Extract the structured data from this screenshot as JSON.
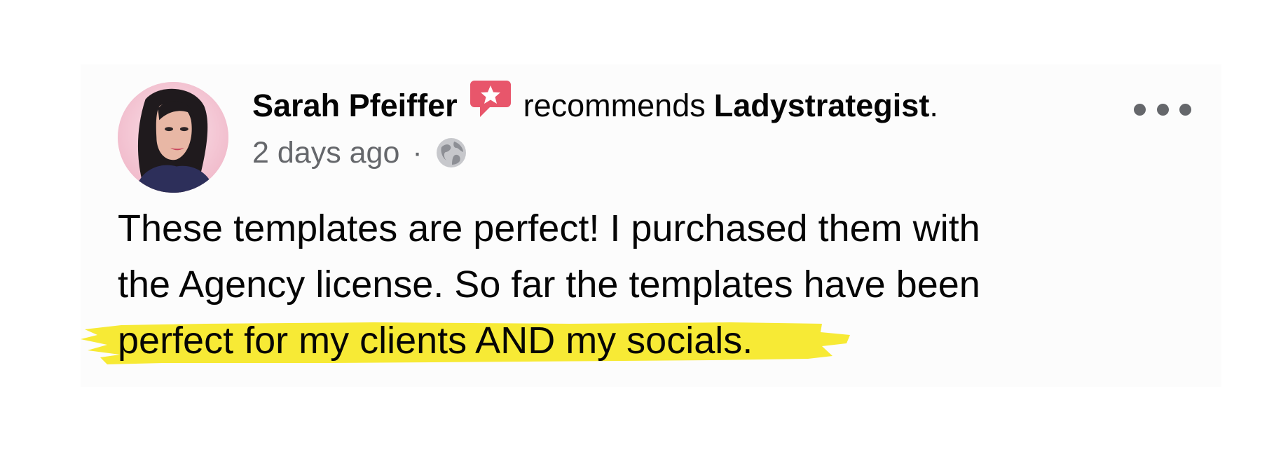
{
  "post": {
    "author": "Sarah Pfeiffer",
    "action": "recommends",
    "page": "Ladystrategist",
    "period": ".",
    "timestamp": "2 days ago",
    "separator": "·",
    "audience_icon": "globe-icon",
    "recommend_icon": "recommend-star-icon",
    "more_icon": "more-options-icon",
    "text_lines": [
      "These templates are perfect! I purchased them with",
      "the Agency license. So far the templates have been"
    ],
    "highlighted_text": "perfect for my clients AND my socials."
  },
  "colors": {
    "text_primary": "#050505",
    "text_secondary": "#65676b",
    "recommend_badge": "#e8566b",
    "highlight": "#f7ea35",
    "card_background": "#fcfcfc"
  }
}
